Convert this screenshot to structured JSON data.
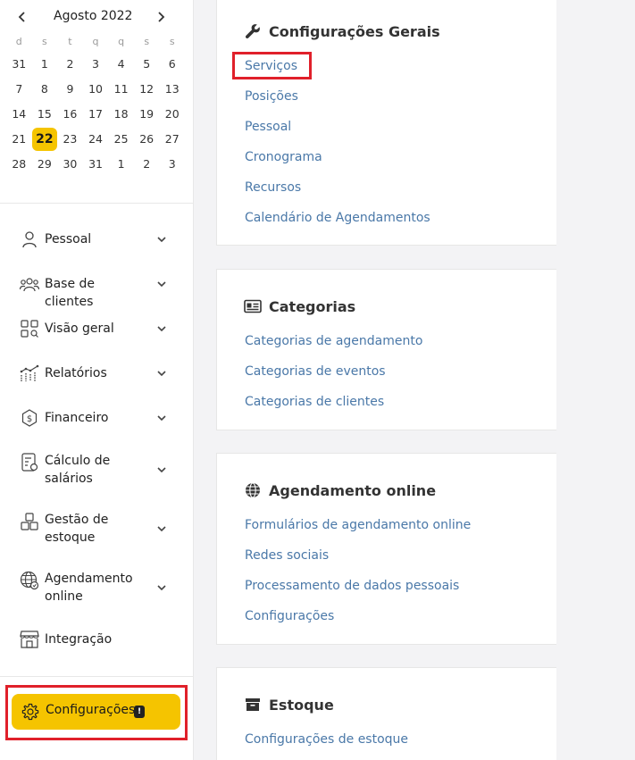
{
  "calendar": {
    "prev_icon": "chevron-left-icon",
    "next_icon": "chevron-right-icon",
    "month_label": "Agosto 2022",
    "weekdays": [
      "d",
      "s",
      "t",
      "q",
      "q",
      "s",
      "s"
    ],
    "weeks": [
      [
        "31",
        "1",
        "2",
        "3",
        "4",
        "5",
        "6"
      ],
      [
        "7",
        "8",
        "9",
        "10",
        "11",
        "12",
        "13"
      ],
      [
        "14",
        "15",
        "16",
        "17",
        "18",
        "19",
        "20"
      ],
      [
        "21",
        "22",
        "23",
        "24",
        "25",
        "26",
        "27"
      ],
      [
        "28",
        "29",
        "30",
        "31",
        "1",
        "2",
        "3"
      ]
    ],
    "today": "22"
  },
  "sidebar": {
    "items": [
      {
        "label": "Pessoal",
        "icon": "person-icon"
      },
      {
        "label": "Base de clientes",
        "icon": "people-icon"
      },
      {
        "label": "Visão geral",
        "icon": "grid-search-icon"
      },
      {
        "label": "Relatórios",
        "icon": "chart-icon"
      },
      {
        "label": "Financeiro",
        "icon": "dollar-icon"
      },
      {
        "label": "Cálculo de salários",
        "icon": "payroll-icon"
      },
      {
        "label": "Gestão de estoque",
        "icon": "boxes-icon"
      },
      {
        "label": "Agendamento online",
        "icon": "globe-icon"
      },
      {
        "label": "Integração",
        "icon": "store-icon"
      }
    ],
    "config": {
      "label": "Configurações",
      "badge": "!",
      "icon": "gear-icon"
    }
  },
  "sections": [
    {
      "title": "Configurações Gerais",
      "icon": "wrench-icon",
      "links": [
        "Serviços",
        "Posições",
        "Pessoal",
        "Cronograma",
        "Recursos",
        "Calendário de Agendamentos"
      ]
    },
    {
      "title": "Categorias",
      "icon": "id-card-icon",
      "links": [
        "Categorias de agendamento",
        "Categorias de eventos",
        "Categorias de clientes"
      ]
    },
    {
      "title": "Agendamento online",
      "icon": "globe-icon",
      "links": [
        "Formulários de agendamento online",
        "Redes sociais",
        "Processamento de dados pessoais",
        "Configurações"
      ]
    },
    {
      "title": "Estoque",
      "icon": "archive-icon",
      "links": [
        "Configurações de estoque"
      ]
    }
  ],
  "colors": {
    "accent": "#f5c400",
    "highlight": "#e0202a",
    "link": "#4a78a8"
  }
}
